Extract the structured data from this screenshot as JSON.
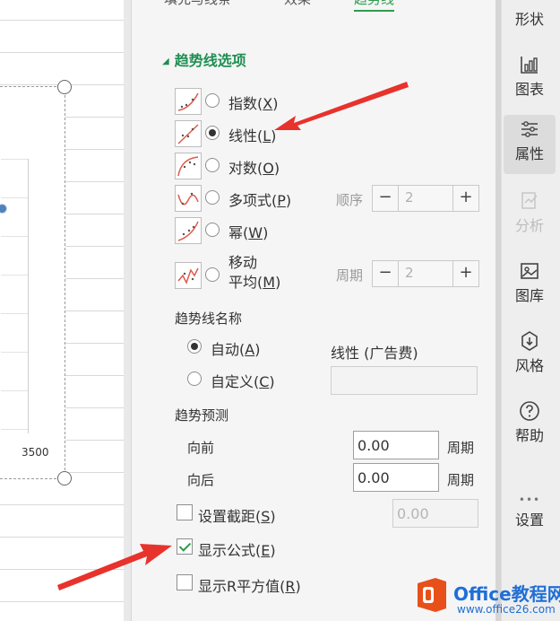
{
  "tabs": [
    "填充与线条",
    "效果",
    "趋势线"
  ],
  "section": {
    "title": "趋势线选项"
  },
  "trend_options": [
    {
      "label": "指数(",
      "key": "X",
      "close": ")",
      "checked": false
    },
    {
      "label": "线性(",
      "key": "L",
      "close": ")",
      "checked": true
    },
    {
      "label": "对数(",
      "key": "O",
      "close": ")",
      "checked": false
    },
    {
      "label": "多项式(",
      "key": "P",
      "close": ")",
      "checked": false
    },
    {
      "label": "幂(",
      "key": "W",
      "close": ")",
      "checked": false
    },
    {
      "label_line1": "移动",
      "label_line2": "平均(",
      "key": "M",
      "close": ")",
      "checked": false
    }
  ],
  "polynomial": {
    "label": "顺序",
    "value": "2",
    "minus": "−",
    "plus": "+"
  },
  "moving_avg": {
    "label": "周期",
    "value": "2",
    "minus": "−",
    "plus": "+"
  },
  "trend_name": {
    "title": "趋势线名称",
    "auto_label": "自动(",
    "auto_key": "A",
    "auto_close": ")",
    "auto_value": "线性 (广告费)",
    "custom_label": "自定义(",
    "custom_key": "C",
    "custom_close": ")",
    "custom_value": ""
  },
  "forecast": {
    "title": "趋势预测",
    "forward_label": "向前",
    "forward_value": "0.00",
    "forward_unit": "周期",
    "backward_label": "向后",
    "backward_value": "0.00",
    "backward_unit": "周期"
  },
  "intercept": {
    "label": "设置截距(",
    "key": "S",
    "close": ")",
    "value": "0.00",
    "checked": false
  },
  "show_formula": {
    "label": "显示公式(",
    "key": "E",
    "close": ")",
    "checked": true
  },
  "show_r2": {
    "label": "显示R平方值(",
    "key": "R",
    "close": ")",
    "checked": false
  },
  "sidebar": {
    "items": [
      "形状",
      "图表",
      "属性",
      "分析",
      "图库",
      "风格",
      "帮助",
      "设置"
    ],
    "more": "•••"
  },
  "chart": {
    "axis_tick": "3500"
  },
  "watermark": {
    "brand": "Office教程网",
    "url": "www.office26.com"
  },
  "colors": {
    "accent": "#2f9b4c",
    "arrow": "#e8322c",
    "brand": "#1f6fd6"
  }
}
